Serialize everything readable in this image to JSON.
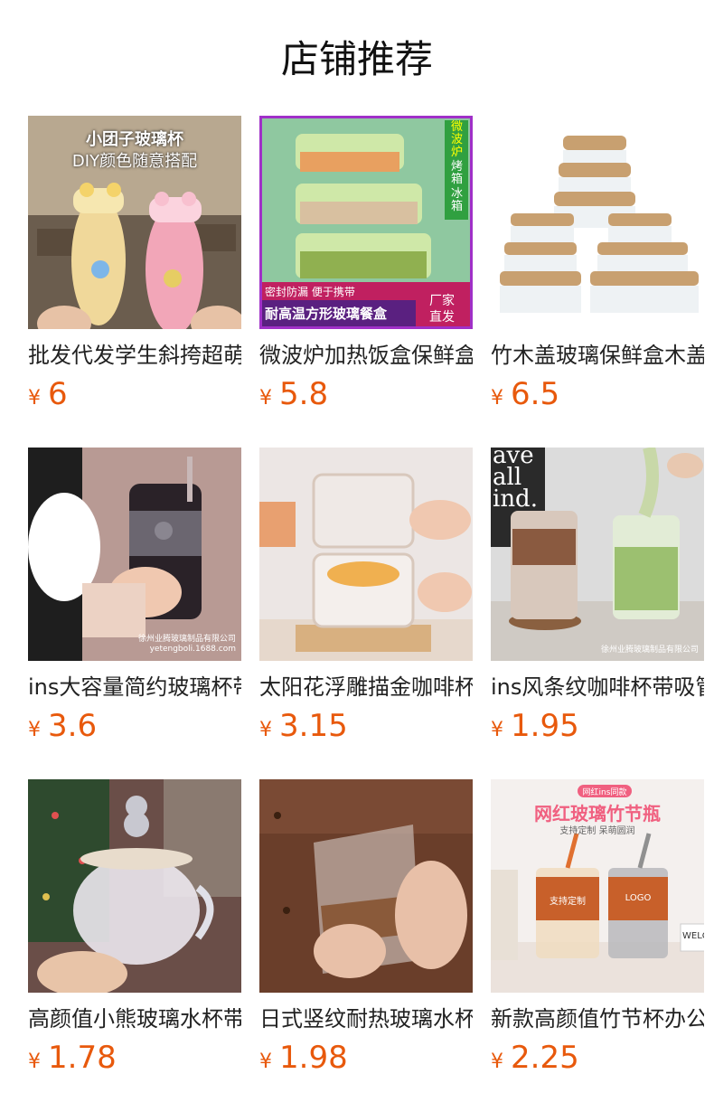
{
  "section_title": "店铺推荐",
  "currency_symbol": "¥",
  "accent_color": "#e8590c",
  "products": [
    {
      "name": "批发代发学生斜挎超萌可爱玻璃杯",
      "price": "6",
      "image_text": [
        "小团子玻璃杯",
        "DIY颜色随意搭配"
      ]
    },
    {
      "name": "微波炉加热饭盒保鲜盒玻璃餐盒",
      "price": "5.8",
      "image_text": [
        "微波炉",
        "烤箱",
        "冰箱",
        "密封防漏 便于携带",
        "耐高温方形玻璃餐盒",
        "厂家",
        "直发"
      ]
    },
    {
      "name": "竹木盖玻璃保鲜盒木盖收纳盒",
      "price": "6.5",
      "image_text": []
    },
    {
      "name": "ins大容量简约玻璃杯带吸管",
      "price": "3.6",
      "image_text": [
        "徐州业腾玻璃制品有限公司",
        "yetengboli.1688.com"
      ]
    },
    {
      "name": "太阳花浮雕描金咖啡杯玻璃杯",
      "price": "3.15",
      "image_text": []
    },
    {
      "name": "ins风条纹咖啡杯带吸管玻璃杯",
      "price": "1.95",
      "image_text": [
        "ave",
        "all",
        "ind.",
        "徐州业腾玻璃制品有限公司"
      ]
    },
    {
      "name": "高颜值小熊玻璃水杯带盖勺",
      "price": "1.78",
      "image_text": []
    },
    {
      "name": "日式竖纹耐热玻璃水杯",
      "price": "1.98",
      "image_text": []
    },
    {
      "name": "新款高颜值竹节杯办公室玻璃杯",
      "price": "2.25",
      "image_text": [
        "网红ins同款",
        "网红玻璃竹节瓶",
        "支持定制 呆萌圆润",
        "支持定制",
        "LOGO",
        "WELC"
      ]
    }
  ]
}
